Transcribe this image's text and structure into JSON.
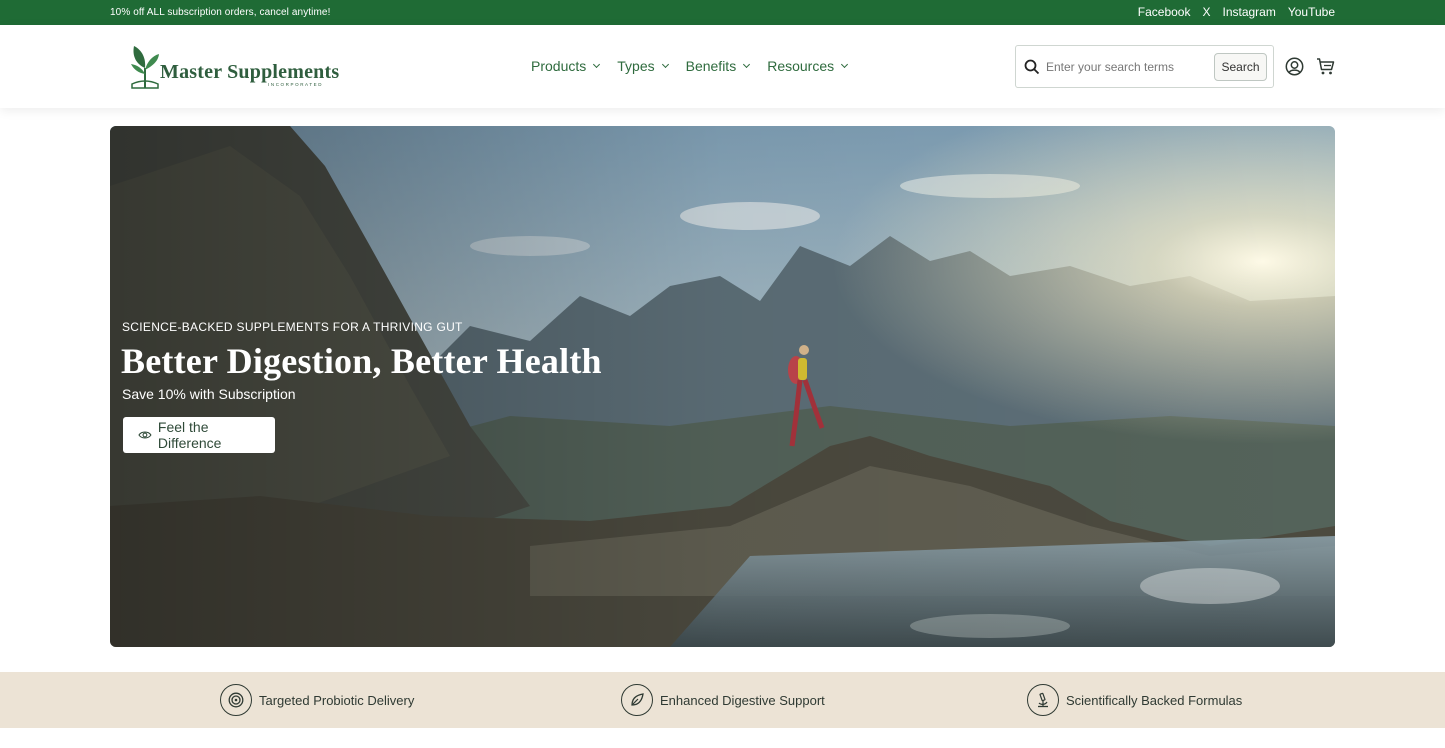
{
  "announcement": {
    "promo": "10% off ALL subscription orders, cancel anytime!",
    "social": [
      "Facebook",
      "X",
      "Instagram",
      "YouTube"
    ]
  },
  "header": {
    "logo_text": "Master Supplements",
    "logo_subtext": "INCORPORATED",
    "nav": [
      "Products",
      "Types",
      "Benefits",
      "Resources"
    ],
    "search": {
      "placeholder": "Enter your search terms",
      "button": "Search"
    },
    "icons": [
      "search-icon",
      "account-icon",
      "cart-icon"
    ]
  },
  "hero": {
    "eyebrow": "SCIENCE-BACKED SUPPLEMENTS FOR A THRIVING GUT",
    "headline": "Better Digestion, Better Health",
    "subline": "Save 10% with Subscription",
    "cta": "Feel the Difference"
  },
  "features": [
    {
      "label": "Targeted Probiotic Delivery",
      "icon": "target-icon"
    },
    {
      "label": "Enhanced Digestive Support",
      "icon": "leaf-icon"
    },
    {
      "label": "Scientifically Backed Formulas",
      "icon": "microscope-icon"
    }
  ],
  "colors": {
    "brand_green": "#1f6b35",
    "nav_green": "#2f6b3e",
    "feature_bg": "#ece3d5"
  }
}
